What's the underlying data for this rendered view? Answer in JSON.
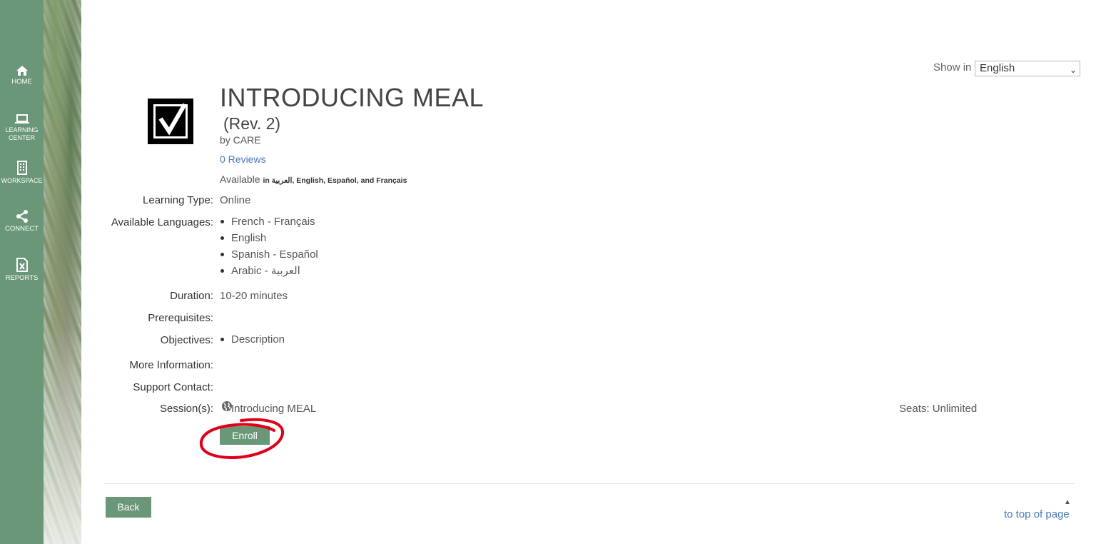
{
  "sidebar": {
    "items": [
      {
        "label": "HOME",
        "icon": "home-icon"
      },
      {
        "label": "LEARNING CENTER",
        "icon": "laptop-icon"
      },
      {
        "label": "WORKSPACE",
        "icon": "building-icon"
      },
      {
        "label": "CONNECT",
        "icon": "share-icon"
      },
      {
        "label": "REPORTS",
        "icon": "excel-file-icon"
      }
    ]
  },
  "language": {
    "label": "Show in",
    "selected": "English"
  },
  "course": {
    "title": "INTRODUCING MEAL",
    "revision": "(Rev. 2)",
    "author": "by CARE",
    "reviews": "0 Reviews",
    "available_prefix": "Available",
    "available_langs": "in العربية, English, Español, and Français"
  },
  "details": {
    "learning_type_label": "Learning Type:",
    "learning_type_value": "Online",
    "languages_label": "Available Languages:",
    "languages": [
      "French - Français",
      "English",
      "Spanish - Español",
      "Arabic - العربية"
    ],
    "duration_label": "Duration:",
    "duration_value": "10-20 minutes",
    "prerequisites_label": "Prerequisites:",
    "objectives_label": "Objectives:",
    "objectives": [
      "Description"
    ],
    "more_info_label": "More Information:",
    "support_label": "Support Contact:",
    "sessions_label": "Session(s):",
    "session_name": "Introducing MEAL",
    "seats": "Seats: Unlimited"
  },
  "actions": {
    "enroll": "Enroll",
    "back": "Back",
    "to_top": "to top of page",
    "to_top_caret": "▲"
  },
  "colors": {
    "accent": "#6a9778",
    "link": "#4a7ab8",
    "annotation": "#e0001a"
  }
}
